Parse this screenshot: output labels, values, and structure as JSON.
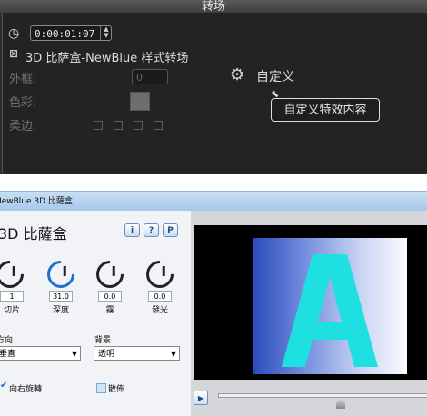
{
  "top_panel": {
    "header_title": "转场",
    "timecode": "0:00:01:07",
    "transition_name": "3D 比萨盒-NewBlue 样式转场",
    "border_label": "外框:",
    "border_value": "0",
    "color_label": "色彩:",
    "soften_label": "柔边:",
    "customize_label": "自定义",
    "tooltip": "自定义特效内容"
  },
  "dialog": {
    "title": "NewBlue 3D 比薩盒",
    "effect_title": "3D 比薩盒",
    "buttons": [
      "i",
      "?",
      "P"
    ],
    "knobs": [
      {
        "label": "切片",
        "value": "1"
      },
      {
        "label": "深度",
        "value": "31.0"
      },
      {
        "label": "霧",
        "value": "0.0"
      },
      {
        "label": "發光",
        "value": "0.0"
      }
    ],
    "direction_label": "方向",
    "direction_value": "垂直",
    "background_label": "背景",
    "background_value": "透明",
    "rotate_right_label": "向右旋轉",
    "rotate_right_checked": true,
    "scatter_label": "散佈",
    "scatter_checked": false,
    "preview_letter": "A",
    "preview_letter_color": "#1ee0e0",
    "play_icon": "play-icon"
  }
}
